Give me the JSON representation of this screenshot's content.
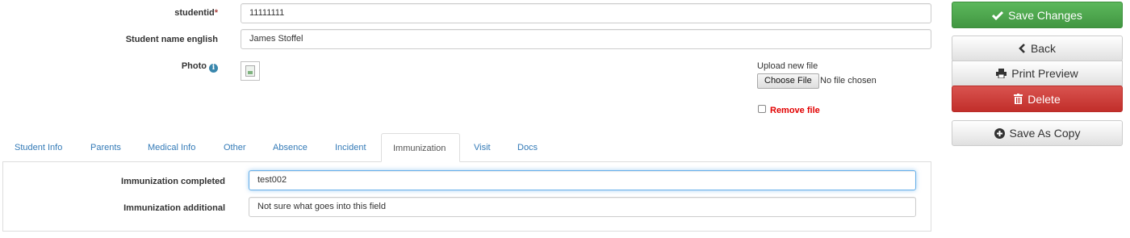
{
  "form": {
    "studentid_label": "studentid",
    "required_marker": "*",
    "studentid_value": "11111111",
    "name_label": "Student name english",
    "name_value": "James Stoffel",
    "photo_label": "Photo",
    "upload_label": "Upload new file",
    "choose_file_label": "Choose File",
    "no_file_text": "No file chosen",
    "remove_file_label": "Remove file"
  },
  "actions": {
    "save": "Save Changes",
    "back": "Back",
    "print": "Print Preview",
    "delete": "Delete",
    "save_copy": "Save As Copy"
  },
  "tabs": [
    {
      "label": "Student Info"
    },
    {
      "label": "Parents"
    },
    {
      "label": "Medical Info"
    },
    {
      "label": "Other"
    },
    {
      "label": "Absence"
    },
    {
      "label": "Incident"
    },
    {
      "label": "Immunization",
      "active": true
    },
    {
      "label": "Visit"
    },
    {
      "label": "Docs"
    }
  ],
  "immunization": {
    "completed_label": "Immunization completed",
    "completed_value": "test002",
    "additional_label": "Immunization additional",
    "additional_value": "Not sure what goes into this field"
  },
  "colors": {
    "success": "#5cb85c",
    "danger": "#d9534f",
    "link": "#337ab7",
    "required": "#a94442",
    "remove": "#e20000"
  },
  "icons": {
    "info": "info-circle-icon",
    "save": "checkmark-icon",
    "back": "chevron-left-icon",
    "print": "printer-icon",
    "delete": "trash-icon",
    "save_copy": "plus-circle-icon",
    "photo": "broken-image-icon"
  }
}
